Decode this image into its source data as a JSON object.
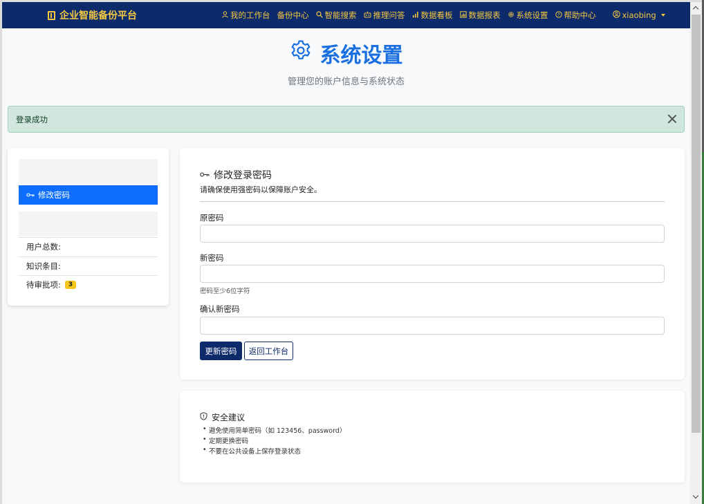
{
  "navbar": {
    "brand": "企业智能备份平台",
    "items": [
      {
        "icon": "person-icon",
        "label": "我的工作台"
      },
      {
        "icon": "",
        "label": "备份中心"
      },
      {
        "icon": "search-icon",
        "label": "智能搜索"
      },
      {
        "icon": "robot-icon",
        "label": "推理问答"
      },
      {
        "icon": "bar-chart-icon",
        "label": "数据看板"
      },
      {
        "icon": "report-icon",
        "label": "数据报表"
      },
      {
        "icon": "gear-icon",
        "label": "系统设置"
      },
      {
        "icon": "question-circle-icon",
        "label": "帮助中心"
      }
    ],
    "user": "xiaobing"
  },
  "header": {
    "title": "系统设置",
    "subtitle": "管理您的账户信息与系统状态"
  },
  "alert": {
    "message": "登录成功"
  },
  "sidebar": {
    "active_item": "修改密码",
    "stats": [
      {
        "label": "用户总数:"
      },
      {
        "label": "知识条目:"
      },
      {
        "label": "待审批项:",
        "badge": "3"
      }
    ]
  },
  "password_form": {
    "title": "修改登录密码",
    "description": "请确保使用强密码以保障账户安全。",
    "old_label": "原密码",
    "new_label": "新密码",
    "new_hint": "密码至少6位字符",
    "confirm_label": "确认新密码",
    "submit_label": "更新密码",
    "back_label": "返回工作台"
  },
  "tips": {
    "title": "安全建议",
    "items": [
      "避免使用简单密码（如 123456、password）",
      "定期更换密码",
      "不要在公共设备上保存登录状态"
    ]
  },
  "colors": {
    "navbar_bg": "#0d2a6b",
    "navbar_text": "#f5c842",
    "accent": "#0d6efd",
    "title": "#1a6fe0",
    "alert_bg": "#d1e7dd",
    "badge": "#f5c518"
  }
}
